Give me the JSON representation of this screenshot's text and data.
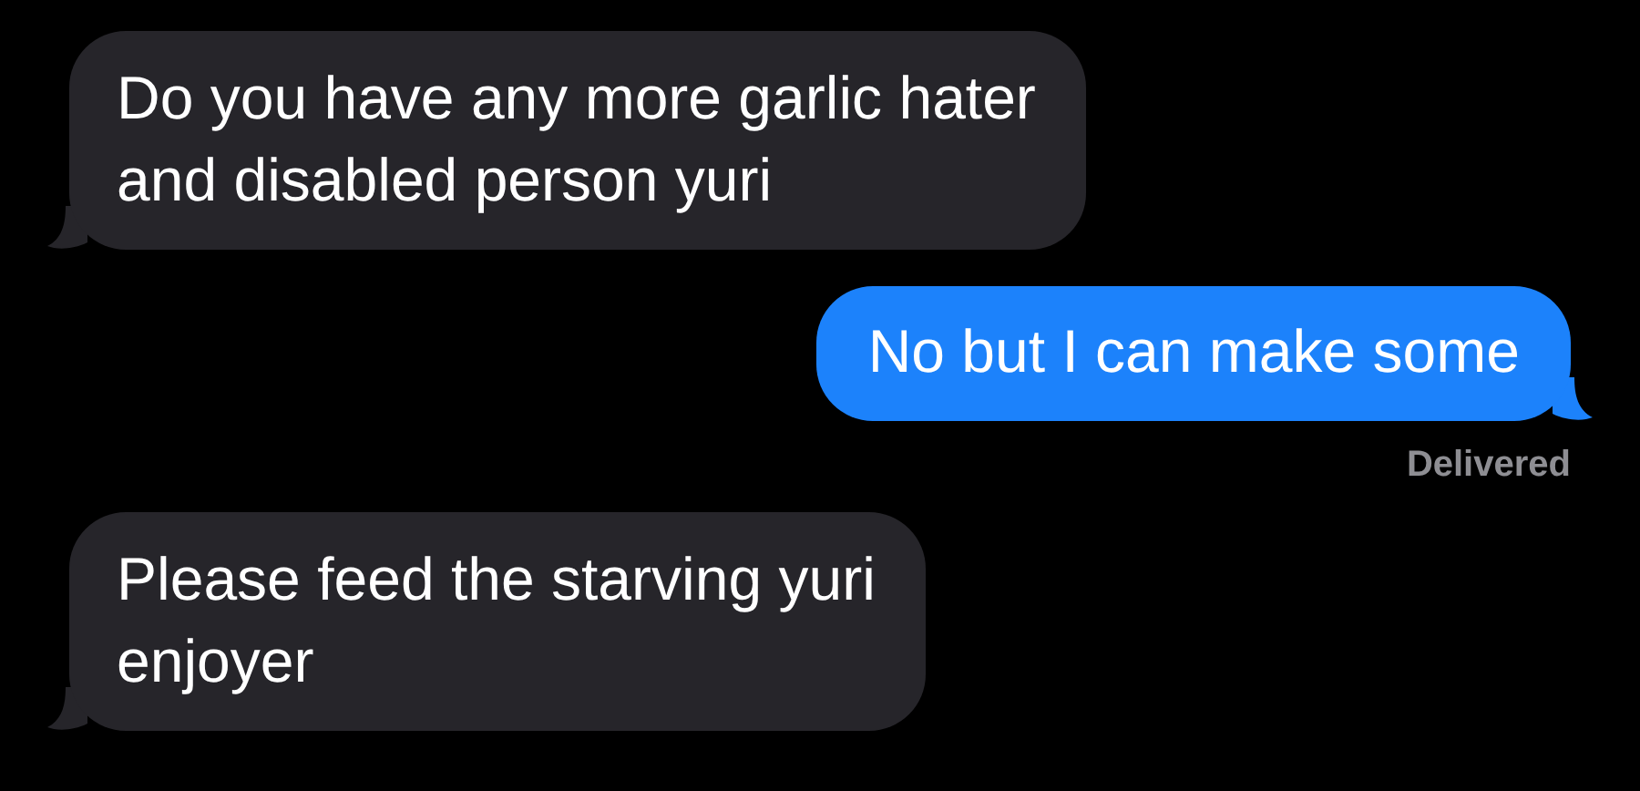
{
  "messages": [
    {
      "kind": "incoming",
      "lines": [
        "Do you have any more garlic hater",
        "and disabled person yuri"
      ]
    },
    {
      "kind": "outgoing",
      "lines": [
        "No but I can make some"
      ],
      "status": "Delivered"
    },
    {
      "kind": "incoming",
      "lines": [
        "Please feed the starving yuri",
        "enjoyer"
      ]
    }
  ]
}
